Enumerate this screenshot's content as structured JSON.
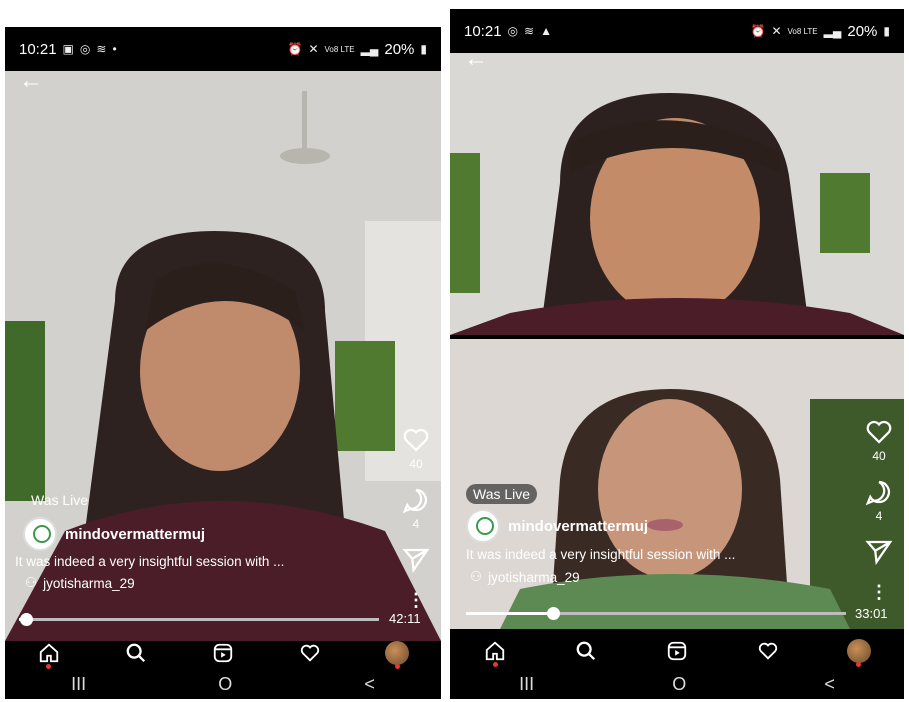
{
  "left": {
    "status": {
      "time": "10:21",
      "battery": "20%",
      "signal": "Vo8 LTE"
    },
    "like_count": "40",
    "comment_count": "4",
    "was_live": "Was Live",
    "account": "mindovermattermuj",
    "caption": "It was indeed a very insightful session with ...",
    "tagged_user": "jyotisharma_29",
    "time_remaining": "42:11",
    "progress_fraction": 0.02
  },
  "right": {
    "status": {
      "time": "10:21",
      "battery": "20%",
      "signal": "Vo8 LTE"
    },
    "like_count": "40",
    "comment_count": "4",
    "was_live": "Was Live",
    "account": "mindovermattermuj",
    "caption": "It was indeed a very insightful session with ...",
    "tagged_user": "jyotisharma_29",
    "time_remaining": "33:01",
    "progress_fraction": 0.23
  },
  "system_nav": {
    "recents": "III",
    "home": "O",
    "back": "<"
  },
  "colors": {
    "background": "#000000",
    "accent_dot": "#e53935"
  }
}
